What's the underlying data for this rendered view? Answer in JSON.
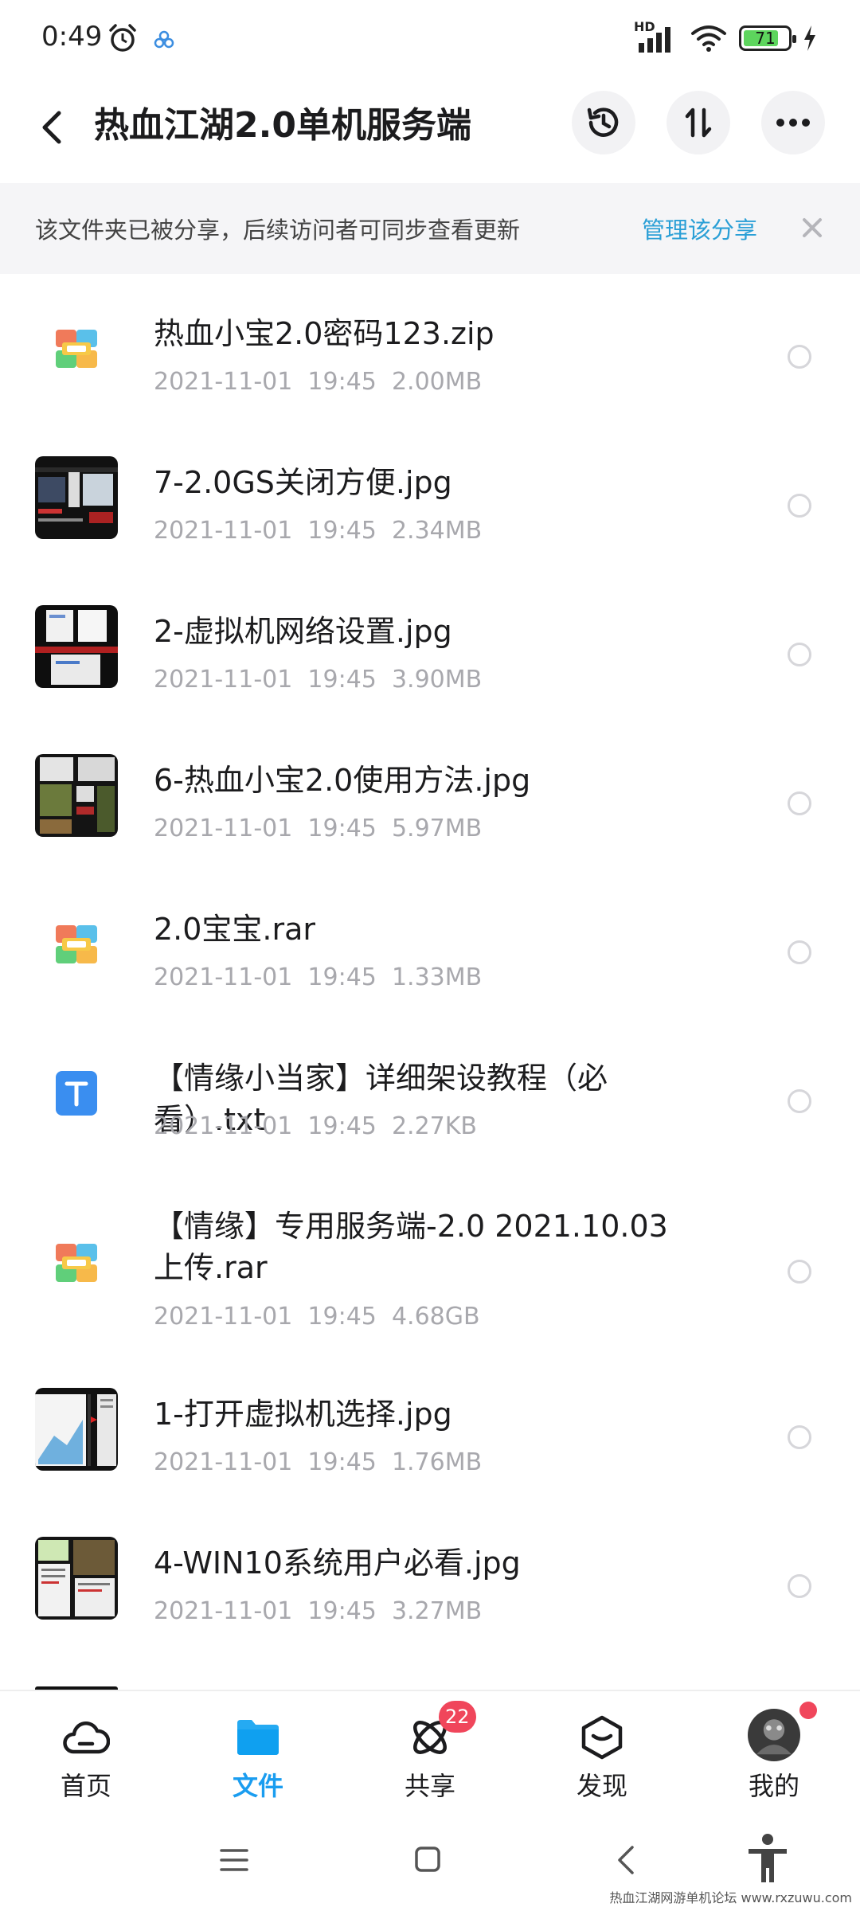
{
  "status_bar": {
    "time": "0:49",
    "network_label": "HD",
    "battery_level": "71"
  },
  "header": {
    "title": "热血江湖2.0单机服务端"
  },
  "banner": {
    "text": "该文件夹已被分享，后续访问者可同步查看更新",
    "link": "管理该分享"
  },
  "files": [
    {
      "name": "热血小宝2.0密码123.zip",
      "meta": "2021-11-01  19:45  2.00MB",
      "icon": "archive-icon"
    },
    {
      "name": "7-2.0GS关闭方便.jpg",
      "meta": "2021-11-01  19:45  2.34MB",
      "icon": "image-thumbnail"
    },
    {
      "name": "2-虚拟机网络设置.jpg",
      "meta": "2021-11-01  19:45  3.90MB",
      "icon": "image-thumbnail"
    },
    {
      "name": "6-热血小宝2.0使用方法.jpg",
      "meta": "2021-11-01  19:45  5.97MB",
      "icon": "image-thumbnail"
    },
    {
      "name": "2.0宝宝.rar",
      "meta": "2021-11-01  19:45  1.33MB",
      "icon": "archive-icon"
    },
    {
      "name": "【情缘小当家】详细架设教程（必看）.txt",
      "meta": "2021-11-01  19:45  2.27KB",
      "icon": "text-file-icon"
    },
    {
      "name": "【情缘】专用服务端-2.0 2021.10.03上传.rar",
      "meta": "2021-11-01  19:45  4.68GB",
      "icon": "archive-icon"
    },
    {
      "name": "1-打开虚拟机选择.jpg",
      "meta": "2021-11-01  19:45  1.76MB",
      "icon": "image-thumbnail"
    },
    {
      "name": "4-WIN10系统用户必看.jpg",
      "meta": "2021-11-01  19:45  3.27MB",
      "icon": "image-thumbnail"
    }
  ],
  "bottom_nav": {
    "home": "首页",
    "files": "文件",
    "share": "共享",
    "share_badge": "22",
    "discover": "发现",
    "me": "我的"
  },
  "watermark": "热血江湖网游单机论坛 www.rxzuwu.com",
  "colors": {
    "accent": "#1a9df0",
    "link": "#2a9fd6",
    "badge": "#f0465b",
    "battery": "#5dd55d"
  }
}
